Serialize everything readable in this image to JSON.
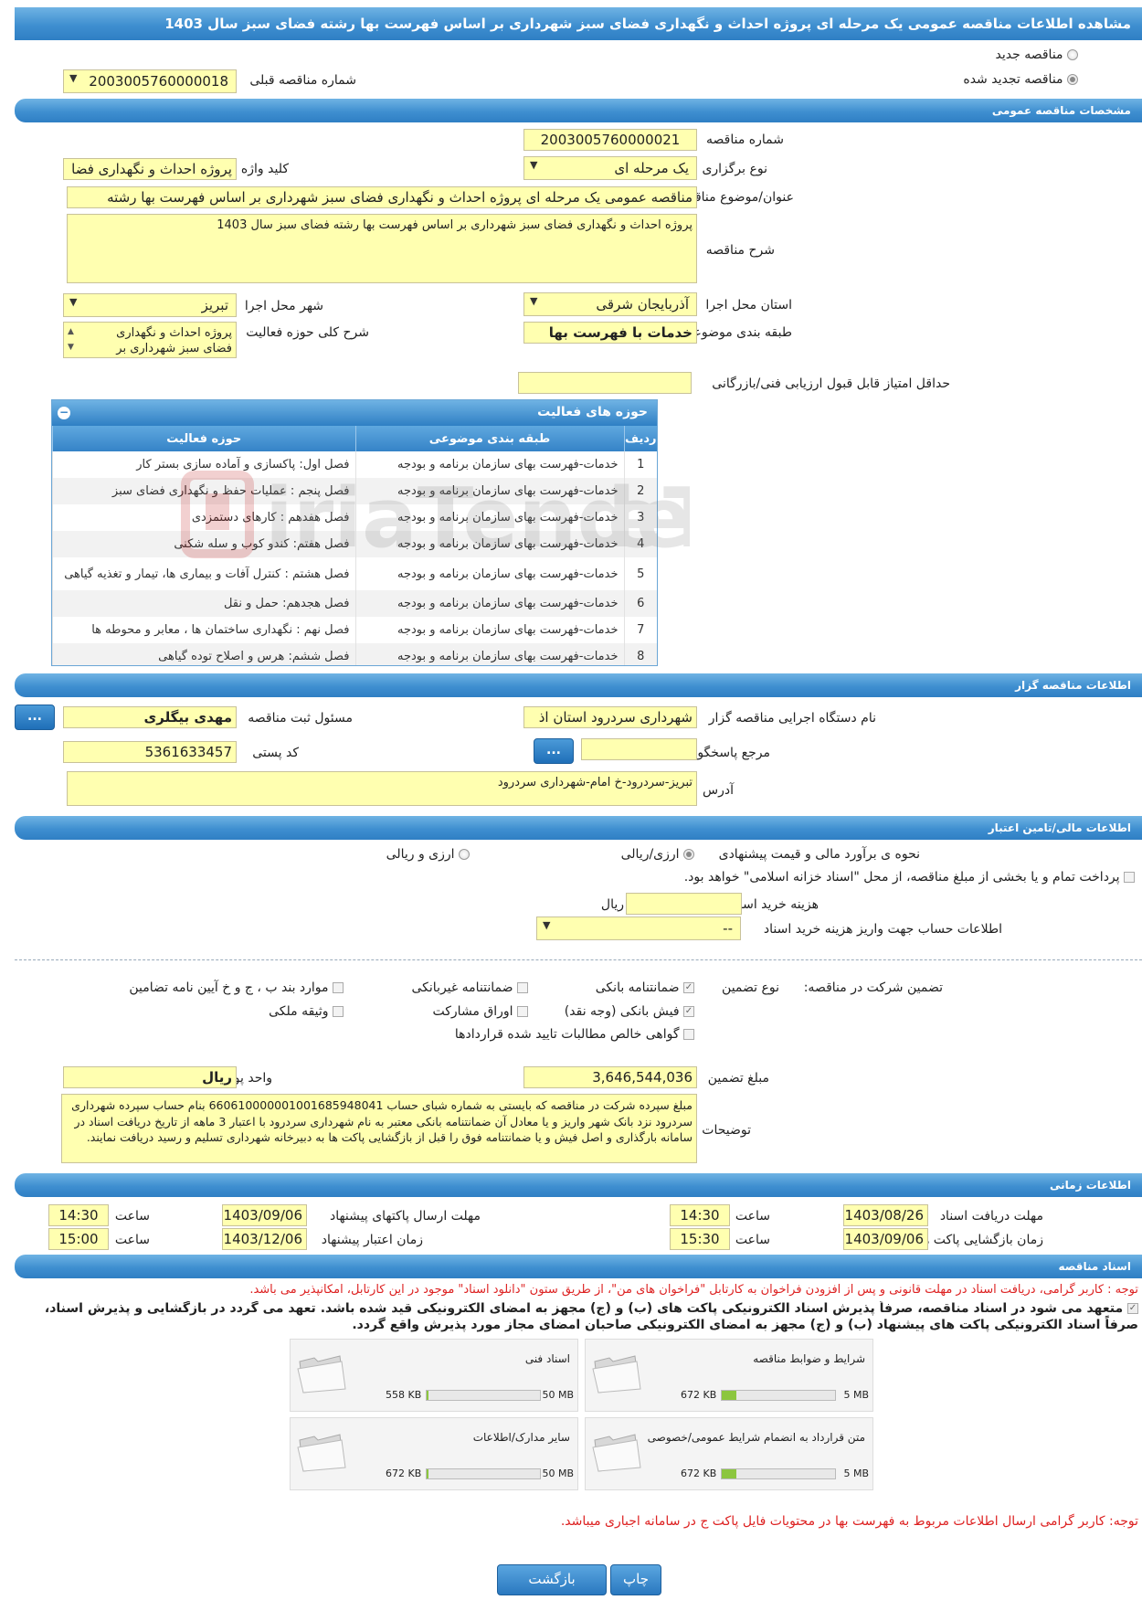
{
  "title": "مشاهده اطلاعات مناقصه عمومی یک مرحله ای پروژه احداث و نگهداری فضای سبز شهرداری بر اساس فهرست بها رشته فضای سبز سال 1403",
  "tender_type": {
    "new_label": "مناقصه جدید",
    "renewed_label": "مناقصه تجدید شده",
    "prev_number_label": "شماره مناقصه قبلی",
    "prev_number": "2003005760000018"
  },
  "sections": {
    "general": "مشخصات مناقصه عمومی",
    "organizer": "اطلاعات مناقصه گزار",
    "financial": "اطلاعات مالی/تامین اعتبار",
    "timing": "اطلاعات زمانی",
    "documents": "اسناد مناقصه"
  },
  "general": {
    "number_label": "شماره مناقصه",
    "number": "2003005760000021",
    "holding_type_label": "نوع برگزاری",
    "holding_type": "یک مرحله ای",
    "keyword_label": "کلید واژه",
    "keyword": "پروژه احداث و نگهداری فضا",
    "subject_label": "عنوان/موضوع مناقصه",
    "subject": "مناقصه عمومی یک مرحله ای پروژه احداث و نگهداری فضای سبز شهرداری بر اساس فهرست بها رشته",
    "description_label": "شرح مناقصه",
    "description": "پروژه احداث و نگهداری فضای سبز شهرداری بر اساس فهرست بها رشته فضای سبز سال 1403",
    "province_label": "استان محل اجرا",
    "province": "آذربایجان شرقی",
    "city_label": "شهر محل اجرا",
    "city": "تبریز",
    "category_label": "طبقه بندی موضوعی",
    "category": "خدمات با فهرست بها",
    "activity_desc_label": "شرح کلی حوزه فعالیت",
    "activity_desc": "پروژه احداث و نگهداری فضای سبز شهرداری بر",
    "min_score_label": "حداقل امتیاز قابل قبول ارزیابی فنی/بازرگانی",
    "min_score": ""
  },
  "activities": {
    "title": "حوزه های فعالیت",
    "columns": [
      "ردیف",
      "طبقه بندی موضوعی",
      "حوزه فعالیت"
    ],
    "rows": [
      {
        "n": "1",
        "cat": "خدمات-فهرست بهای سازمان برنامه و بودجه",
        "area": "فصل اول: پاکسازی و آماده سازی بستر کار"
      },
      {
        "n": "2",
        "cat": "خدمات-فهرست بهای سازمان برنامه و بودجه",
        "area": "فصل پنجم : عملیات حفظ و نگهداری فضای سبز"
      },
      {
        "n": "3",
        "cat": "خدمات-فهرست بهای سازمان برنامه و بودجه",
        "area": "فصل هفدهم : کارهای دستمزدی"
      },
      {
        "n": "4",
        "cat": "خدمات-فهرست بهای سازمان برنامه و بودجه",
        "area": "فصل هفتم: کندو کوب و سله شکنی"
      },
      {
        "n": "5",
        "cat": "خدمات-فهرست بهای سازمان برنامه و بودجه",
        "area": "فصل هشتم : کنترل آفات و بیماری ها، تیمار و تغذیه گیاهی"
      },
      {
        "n": "6",
        "cat": "خدمات-فهرست بهای سازمان برنامه و بودجه",
        "area": "فصل هجدهم: حمل و نقل"
      },
      {
        "n": "7",
        "cat": "خدمات-فهرست بهای سازمان برنامه و بودجه",
        "area": "فصل نهم : نگهداری ساختمان ها ، معابر و محوطه ها"
      },
      {
        "n": "8",
        "cat": "خدمات-فهرست بهای سازمان برنامه و بودجه",
        "area": "فصل ششم: هرس و اصلاح توده گیاهی"
      }
    ]
  },
  "organizer": {
    "org_label": "نام دستگاه اجرایی مناقصه گزار",
    "org": "شهرداری سردرود استان اذ",
    "officer_label": "مسئول ثبت مناقصه",
    "officer": "مهدی بیگلری",
    "ref_label": "مرجع پاسخگویی",
    "ref": "",
    "postal_label": "کد پستی",
    "postal": "5361633457",
    "address_label": "آدرس",
    "address": "تبریز-سردرود-خ امام-شهرداری سردرود",
    "dots": "..."
  },
  "financial": {
    "estimate_label": "نحوه ی برآورد مالی و قیمت پیشنهادی",
    "opt1": "ارزی/ریالی",
    "opt2": "ارزی و ریالی",
    "treasury_text": "پرداخت تمام و یا بخشی از مبلغ مناقصه، از محل \"اسناد خزانه اسلامی\" خواهد بود.",
    "doc_cost_label": "هزینه خرید اسناد",
    "doc_cost": "",
    "currency": "ریال",
    "account_label": "اطلاعات حساب جهت واریز هزینه خرید اسناد",
    "account": "--"
  },
  "guarantee": {
    "label": "تضمین شرکت در مناقصه:",
    "type_label": "نوع تضمین",
    "items": [
      "ضمانتنامه بانکی",
      "ضمانتنامه غیربانکی",
      "موارد بند ب ، ج و خ آیین نامه تضامین",
      "فیش بانکی (وجه نقد)",
      "اوراق مشارکت",
      "وثیقه ملکی",
      "گواهی خالص مطالبات تایید شده قراردادها"
    ],
    "amount_label": "مبلغ تضمین",
    "amount": "3,646,544,036",
    "unit_label": "واحد پول",
    "unit": "ریال",
    "notes_label": "توضیحات",
    "notes": "مبلغ سپرده شرکت در مناقصه که بایستی به شماره شبای حساب 660610000001001685948041 بنام حساب سپرده شهرداری سردرود نزد بانک شهر واریز و یا معادل آن ضمانتنامه بانکی معتبر به نام شهرداری سردرود با اعتبار 3 ماهه از تاریخ دریافت اسناد در سامانه بارگذاری و اصل فیش و یا ضمانتنامه فوق را قبل از بازگشایی پاکت ها به دبیرخانه شهرداری تسلیم و رسید دریافت نمایند."
  },
  "timing": {
    "receive_label": "مهلت دریافت اسناد",
    "receive_date": "1403/08/26",
    "receive_time": "14:30",
    "submit_label": "مهلت ارسال پاکتهای پیشنهاد",
    "submit_date": "1403/09/06",
    "submit_time": "14:30",
    "open_label": "زمان بازگشایی پاکت ها",
    "open_date": "1403/09/06",
    "open_time": "15:30",
    "valid_label": "زمان اعتبار پیشنهاد",
    "valid_date": "1403/12/06",
    "valid_time": "15:00",
    "time_label": "ساعت"
  },
  "documents": {
    "note1": "توجه : کاربر گرامی، دریافت اسناد در مهلت قانونی و پس از افزودن فراخوان به کارتابل \"فراخوان های من\"، از طریق ستون \"دانلود اسناد\" موجود در این کارتابل، امکانپذیر می باشد.",
    "commit1": "متعهد می شود در اسناد مناقصه، صرفاً پذیرش اسناد الکترونیکی پاکت های (ب) و (ج) مجهز به امضای الکترونیکی قید شده باشد. تعهد می گردد در بازگشایی و پذیرش اسناد،",
    "commit2": "صرفاً اسناد الکترونیکی پاکت های پیشنهاد (ب) و (ج) مجهز به امضای الکترونیکی صاحبان امضای مجاز مورد پذیرش واقع گردد.",
    "files": [
      {
        "name": "شرایط و ضوابط مناقصه",
        "size": "672 KB",
        "max": "5 MB",
        "fill": 0.13
      },
      {
        "name": "اسناد فنی",
        "size": "558 KB",
        "max": "50 MB",
        "fill": 0.02
      },
      {
        "name": "متن قرارداد به انضمام شرایط عمومی/خصوصی",
        "size": "672 KB",
        "max": "5 MB",
        "fill": 0.13
      },
      {
        "name": "سایر مدارک/اطلاعات",
        "size": "672 KB",
        "max": "50 MB",
        "fill": 0.02
      }
    ],
    "note2": "توجه: کاربر گرامی ارسال اطلاعات مربوط به فهرست بها در محتویات فایل پاکت ج در سامانه اجباری میباشد."
  },
  "buttons": {
    "back": "بازگشت",
    "print": "چاپ"
  }
}
